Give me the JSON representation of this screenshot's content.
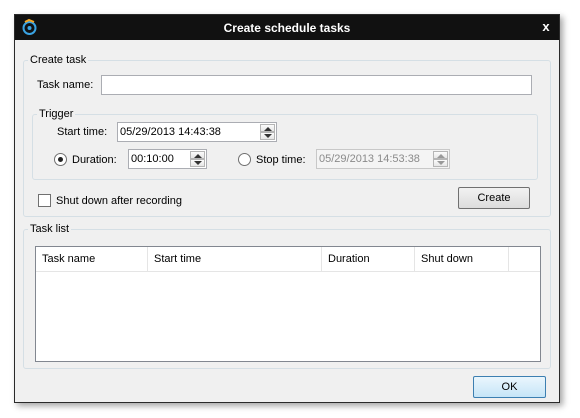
{
  "window": {
    "title": "Create schedule tasks",
    "close_label": "x"
  },
  "create_task": {
    "group_label": "Create task",
    "task_name_label": "Task name:",
    "task_name_value": "",
    "trigger": {
      "group_label": "Trigger",
      "start_time_label": "Start time:",
      "start_time_value": "05/29/2013 14:43:38",
      "duration_label": "Duration:",
      "duration_value": "00:10:00",
      "duration_selected": true,
      "stop_time_label": "Stop time:",
      "stop_time_value": "05/29/2013 14:53:38",
      "stop_time_selected": false
    },
    "shutdown_label": "Shut down after recording",
    "shutdown_checked": false,
    "create_button": "Create"
  },
  "task_list": {
    "group_label": "Task list",
    "columns": [
      "Task name",
      "Start time",
      "Duration",
      "Shut down"
    ],
    "rows": []
  },
  "ok_button": "OK",
  "colors": {
    "titlebar": "#111111",
    "dialog_bg": "#f0f0f0",
    "icon_accent": "#3aa3e3",
    "icon_orange": "#f5a623"
  }
}
